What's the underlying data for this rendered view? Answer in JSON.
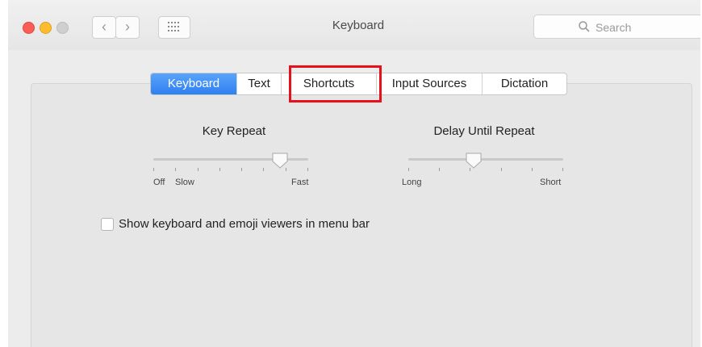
{
  "window": {
    "title": "Keyboard"
  },
  "toolbar": {
    "back": "‹",
    "forward": "›"
  },
  "search": {
    "placeholder": "Search"
  },
  "tabs": [
    {
      "label": "Keyboard",
      "active": true
    },
    {
      "label": "Text",
      "active": false
    },
    {
      "label": "Shortcuts",
      "active": false,
      "highlighted": true
    },
    {
      "label": "Input Sources",
      "active": false
    },
    {
      "label": "Dictation",
      "active": false
    }
  ],
  "key_repeat": {
    "title": "Key Repeat",
    "labels": {
      "off": "Off",
      "slow": "Slow",
      "fast": "Fast"
    },
    "value_fraction": 0.82
  },
  "delay_until_repeat": {
    "title": "Delay Until Repeat",
    "labels": {
      "long": "Long",
      "short": "Short"
    },
    "value_fraction": 0.42
  },
  "checkbox": {
    "label": "Show keyboard and emoji viewers in menu bar",
    "checked": false
  },
  "colors": {
    "accent": "#2f80f0",
    "highlight": "#e8111a"
  }
}
